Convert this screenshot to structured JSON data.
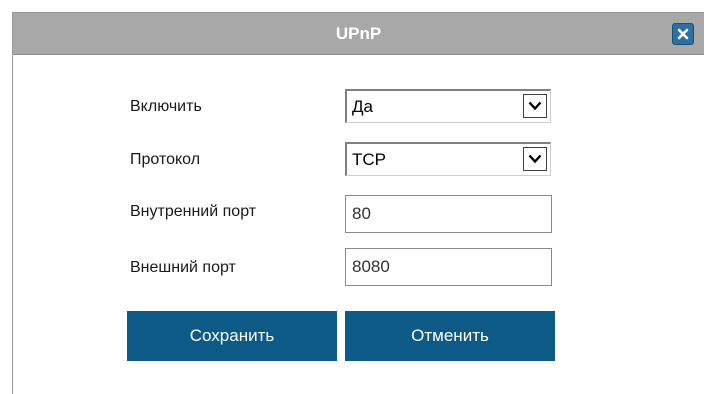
{
  "dialog": {
    "title": "UPnP",
    "close_icon": "close-icon"
  },
  "form": {
    "enable": {
      "label": "Включить",
      "value": "Да"
    },
    "protocol": {
      "label": "Протокол",
      "value": "TCP"
    },
    "internal_port": {
      "label": "Внутренний порт",
      "value": "80"
    },
    "external_port": {
      "label": "Внешний порт",
      "value": "8080"
    }
  },
  "buttons": {
    "save_label": "Сохранить",
    "cancel_label": "Отменить"
  },
  "colors": {
    "titlebar": "#a8a8a8",
    "button_bg": "#0e5a86",
    "close_bg": "#2d6fa0"
  }
}
